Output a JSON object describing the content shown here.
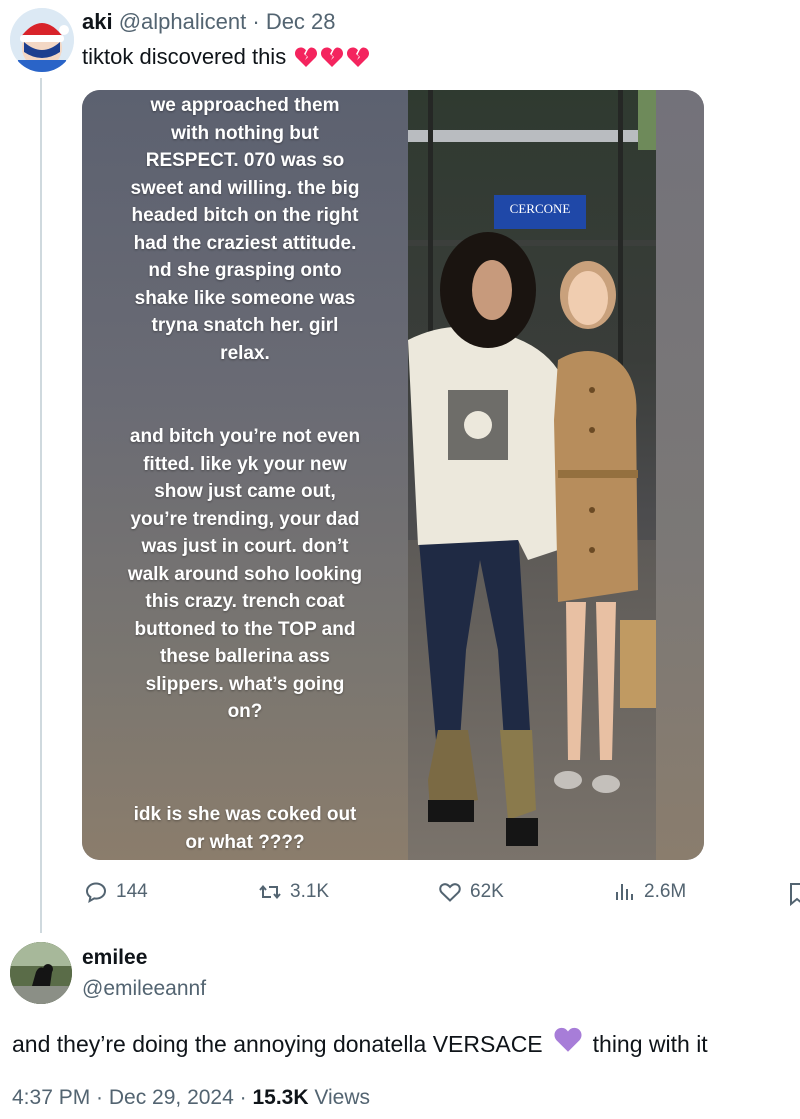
{
  "quoted_tweet": {
    "display_name": "aki",
    "handle": "@alphalicent",
    "separator": " · ",
    "date": "Dec 28",
    "text": "tiktok discovered this",
    "emoji": [
      "broken-heart",
      "broken-heart",
      "broken-heart"
    ],
    "media": {
      "story_text_1": "we approached them\nwith nothing but\nRESPECT. 070 was so\nsweet and willing. the big\nheaded bitch on the right\nhad the craziest attitude.\nnd she grasping onto\nshake like someone was\ntryna snatch her. girl\nrelax.",
      "story_text_2": "and bitch you’re not even\nfitted. like yk your new\nshow just came out,\nyou’re trending, your dad\nwas just in court. don’t\nwalk around soho looking\nthis crazy. trench coat\nbuttoned to the TOP and\nthese ballerina ass\nslippers. what’s going\non?",
      "story_text_3": "idk is she was coked out\nor what ????",
      "sign_text": "CERCONE"
    },
    "actions": {
      "replies": "144",
      "retweets": "3.1K",
      "likes": "62K",
      "views": "2.6M"
    }
  },
  "main_tweet": {
    "display_name": "emilee",
    "handle": "@emileeannf",
    "text_before": "and they’re doing the annoying donatella VERSACE",
    "text_after": "thing with it",
    "emoji": "purple-heart",
    "timestamp": "4:37 PM · Dec 29, 2024 · ",
    "views_count": "15.3K",
    "views_label": " Views"
  },
  "colors": {
    "text_primary": "#0f1419",
    "text_secondary": "#536471",
    "broken_heart": "#f4245e",
    "purple_heart": "#a77dd8",
    "thread_line": "#cfd9de"
  }
}
